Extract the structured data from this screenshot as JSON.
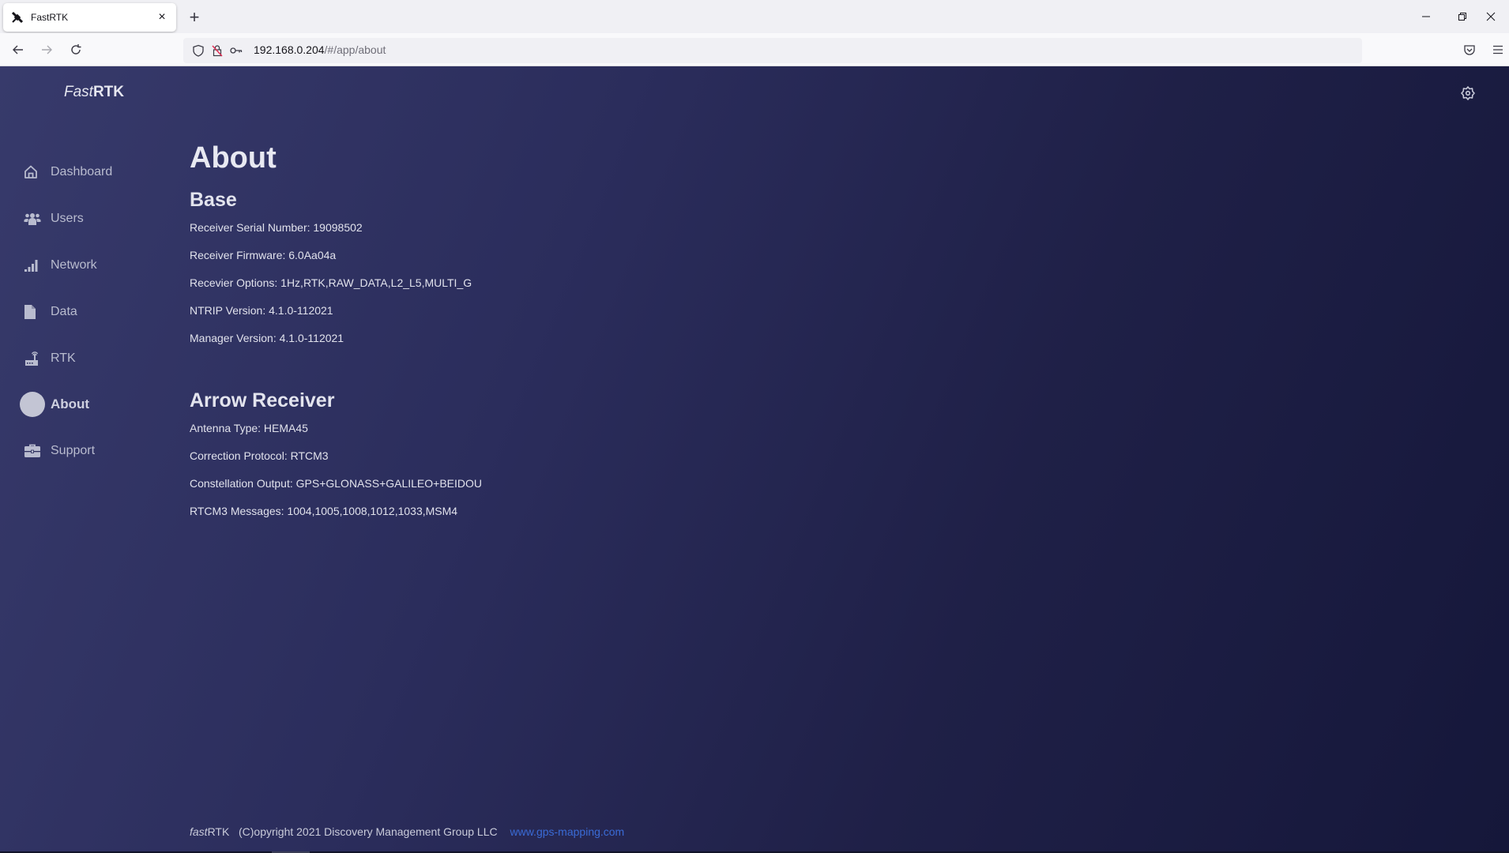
{
  "browser": {
    "tab": {
      "title": "FastRTK",
      "favicon": "satellite-icon",
      "close": "×"
    },
    "new_tab": "+",
    "window_controls": {
      "minimize": "minimize-icon",
      "restore": "restore-icon",
      "close": "close-icon"
    },
    "url": {
      "host": "192.168.0.204",
      "path": "/#/app/about"
    }
  },
  "app": {
    "logo": {
      "italic": "Fast",
      "bold": "RTK"
    },
    "settings_icon": "gear-icon"
  },
  "sidebar": {
    "items": [
      {
        "label": "Dashboard",
        "icon": "home-icon",
        "active": false
      },
      {
        "label": "Users",
        "icon": "users-icon",
        "active": false
      },
      {
        "label": "Network",
        "icon": "signal-icon",
        "active": false
      },
      {
        "label": "Data",
        "icon": "file-icon",
        "active": false
      },
      {
        "label": "RTK",
        "icon": "router-icon",
        "active": false
      },
      {
        "label": "About",
        "icon": "circle-icon",
        "active": true
      },
      {
        "label": "Support",
        "icon": "briefcase-icon",
        "active": false
      }
    ]
  },
  "main": {
    "title": "About",
    "sections": [
      {
        "heading": "Base",
        "lines": [
          "Receiver Serial Number: 19098502",
          "Receiver Firmware: 6.0Aa04a",
          "Recevier Options: 1Hz,RTK,RAW_DATA,L2_L5,MULTI_G",
          "NTRIP Version: 4.1.0-112021",
          "Manager Version: 4.1.0-112021"
        ]
      },
      {
        "heading": "Arrow Receiver",
        "lines": [
          "Antenna Type: HEMA45",
          "Correction Protocol: RTCM3",
          "Constellation Output: GPS+GLONASS+GALILEO+BEIDOU",
          "RTCM3 Messages: 1004,1005,1008,1012,1033,MSM4"
        ]
      }
    ]
  },
  "footer": {
    "brand_italic": "fast",
    "brand_rest": "RTK",
    "copyright": "(C)opyright 2021 Discovery Management Group LLC",
    "link": "www.gps-mapping.com"
  },
  "colors": {
    "bg_gradient_start": "#373a6b",
    "bg_gradient_end": "#15173a",
    "link": "#3a6bd6",
    "sidebar_text": "#b9bccf",
    "content_text": "#e1e2ec"
  }
}
